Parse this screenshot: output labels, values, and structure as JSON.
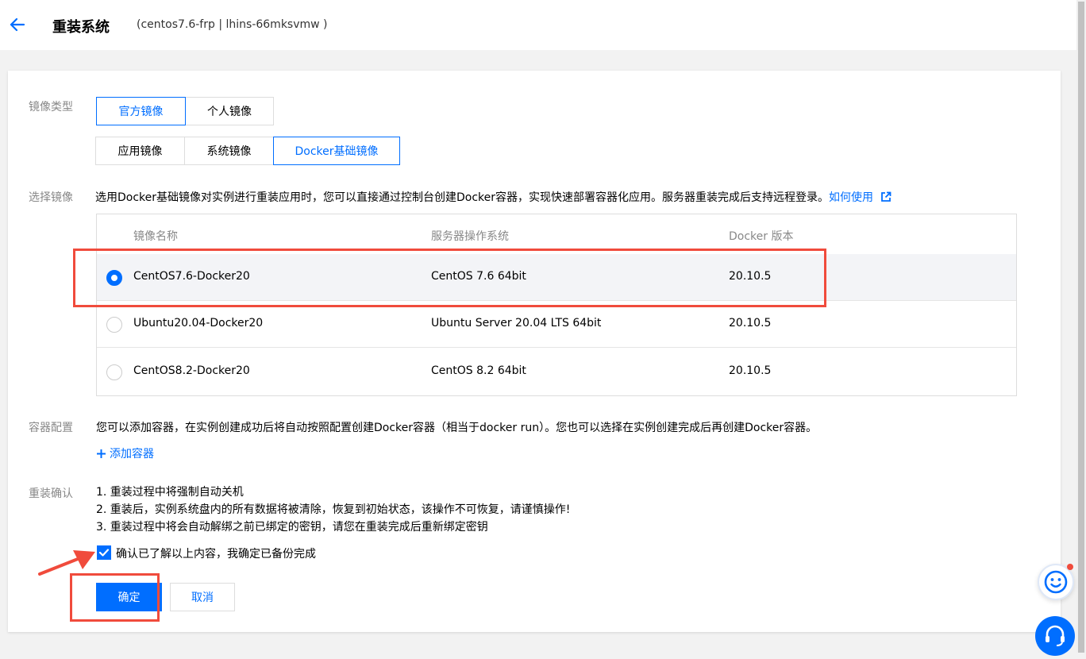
{
  "header": {
    "title": "重装系统",
    "subtitle": "(centos7.6-frp | lhins-66mksvmw )"
  },
  "form": {
    "image_type_label": "镜像类型",
    "image_type_tabs": [
      "官方镜像",
      "个人镜像"
    ],
    "image_subtype_tabs": [
      "应用镜像",
      "系统镜像",
      "Docker基础镜像"
    ],
    "select_image_label": "选择镜像",
    "select_image_desc": "选用Docker基础镜像对实例进行重装应用时，您可以直接通过控制台创建Docker容器，实现快速部署容器化应用。服务器重装完成后支持远程登录。",
    "how_to_use_link": "如何使用",
    "table": {
      "headers": [
        "镜像名称",
        "服务器操作系统",
        "Docker 版本"
      ],
      "rows": [
        {
          "name": "CentOS7.6-Docker20",
          "os": "CentOS 7.6 64bit",
          "docker": "20.10.5"
        },
        {
          "name": "Ubuntu20.04-Docker20",
          "os": "Ubuntu Server 20.04 LTS 64bit",
          "docker": "20.10.5"
        },
        {
          "name": "CentOS8.2-Docker20",
          "os": "CentOS 8.2 64bit",
          "docker": "20.10.5"
        }
      ]
    },
    "container_label": "容器配置",
    "container_desc": "您可以添加容器，在实例创建成功后将自动按照配置创建Docker容器（相当于docker run）。您也可以选择在实例创建完成后再创建Docker容器。",
    "add_container_link": "添加容器",
    "confirm_label": "重装确认",
    "confirm_items": [
      "1. 重装过程中将强制自动关机",
      "2. 重装后，实例系统盘内的所有数据将被清除，恢复到初始状态，该操作不可恢复，请谨慎操作!",
      "3. 重装过程中将会自动解绑之前已绑定的密钥，请您在重装完成后重新绑定密钥"
    ],
    "confirm_checkbox_label": "确认已了解以上内容，我确定已备份完成",
    "ok_button": "确定",
    "cancel_button": "取消"
  },
  "colors": {
    "accent": "#006eff",
    "annotation": "#f04b3c"
  },
  "icons": [
    "back-arrow-icon",
    "external-link-icon",
    "plus-icon",
    "check-icon",
    "smiley-icon",
    "headset-icon"
  ]
}
